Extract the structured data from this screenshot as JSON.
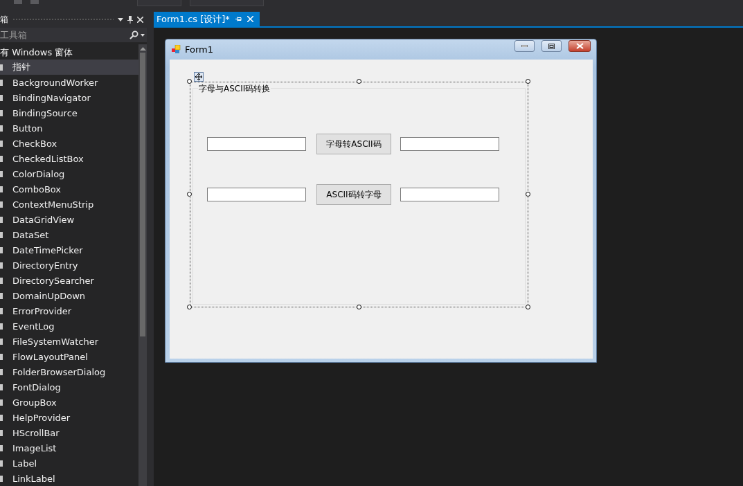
{
  "toolbox": {
    "title": "箱",
    "search": {
      "placeholder": "工具箱"
    },
    "category": {
      "label": "有 Windows 窗体"
    },
    "items": [
      {
        "label": "指针",
        "selected": true
      },
      {
        "label": "BackgroundWorker",
        "selected": false
      },
      {
        "label": "BindingNavigator",
        "selected": false
      },
      {
        "label": "BindingSource",
        "selected": false
      },
      {
        "label": "Button",
        "selected": false
      },
      {
        "label": "CheckBox",
        "selected": false
      },
      {
        "label": "CheckedListBox",
        "selected": false
      },
      {
        "label": "ColorDialog",
        "selected": false
      },
      {
        "label": "ComboBox",
        "selected": false
      },
      {
        "label": "ContextMenuStrip",
        "selected": false
      },
      {
        "label": "DataGridView",
        "selected": false
      },
      {
        "label": "DataSet",
        "selected": false
      },
      {
        "label": "DateTimePicker",
        "selected": false
      },
      {
        "label": "DirectoryEntry",
        "selected": false
      },
      {
        "label": "DirectorySearcher",
        "selected": false
      },
      {
        "label": "DomainUpDown",
        "selected": false
      },
      {
        "label": "ErrorProvider",
        "selected": false
      },
      {
        "label": "EventLog",
        "selected": false
      },
      {
        "label": "FileSystemWatcher",
        "selected": false
      },
      {
        "label": "FlowLayoutPanel",
        "selected": false
      },
      {
        "label": "FolderBrowserDialog",
        "selected": false
      },
      {
        "label": "FontDialog",
        "selected": false
      },
      {
        "label": "GroupBox",
        "selected": false
      },
      {
        "label": "HelpProvider",
        "selected": false
      },
      {
        "label": "HScrollBar",
        "selected": false
      },
      {
        "label": "ImageList",
        "selected": false
      },
      {
        "label": "Label",
        "selected": false
      },
      {
        "label": "LinkLabel",
        "selected": false
      }
    ]
  },
  "document_tab": {
    "label": "Form1.cs [设计]*",
    "selected": true
  },
  "form": {
    "title": "Form1",
    "group_box": {
      "title": "字母与ASCII码转换",
      "selected": true,
      "rows": [
        {
          "button": "字母转ASCII码"
        },
        {
          "button": "ASCII码转字母"
        }
      ]
    }
  }
}
